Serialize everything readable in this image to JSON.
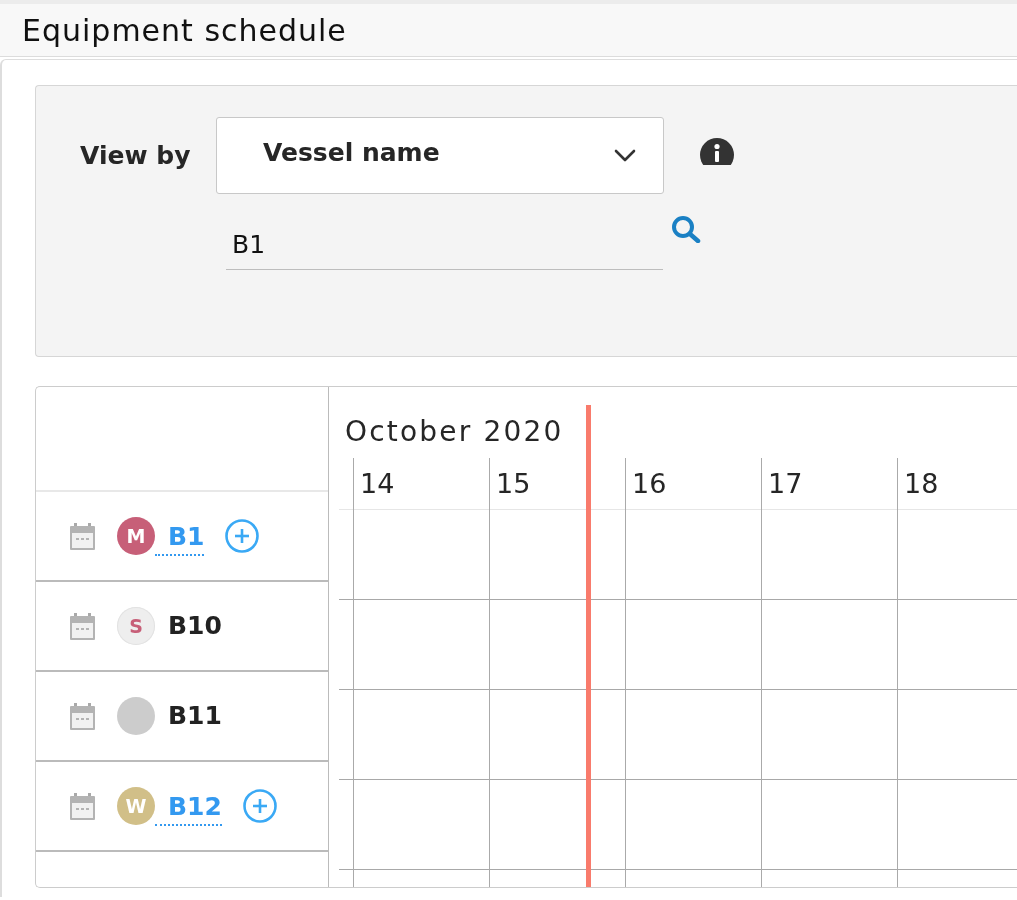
{
  "header": {
    "title": "Equipment schedule"
  },
  "filter": {
    "view_by": {
      "label": "View by",
      "value": "Vessel name"
    },
    "search": {
      "value": "B1"
    }
  },
  "schedule": {
    "month": "October 2020",
    "days": [
      {
        "label": "14",
        "today": false
      },
      {
        "label": "15",
        "today": true
      },
      {
        "label": "16",
        "today": false
      },
      {
        "label": "17",
        "today": false
      },
      {
        "label": "18",
        "today": false
      }
    ],
    "vessels": [
      {
        "name": "B1",
        "link": true,
        "add_button": true,
        "avatar": {
          "kind": "filled",
          "letter": "M",
          "color": "#c75f78"
        }
      },
      {
        "name": "B10",
        "link": false,
        "add_button": false,
        "avatar": {
          "kind": "tinted",
          "letter": "S",
          "color": "#c75f78"
        }
      },
      {
        "name": "B11",
        "link": false,
        "add_button": false,
        "avatar": {
          "kind": "blank",
          "color": "#cccccc"
        }
      },
      {
        "name": "B12",
        "link": true,
        "add_button": true,
        "avatar": {
          "kind": "filled",
          "letter": "W",
          "color": "#d1bf88"
        }
      }
    ]
  }
}
